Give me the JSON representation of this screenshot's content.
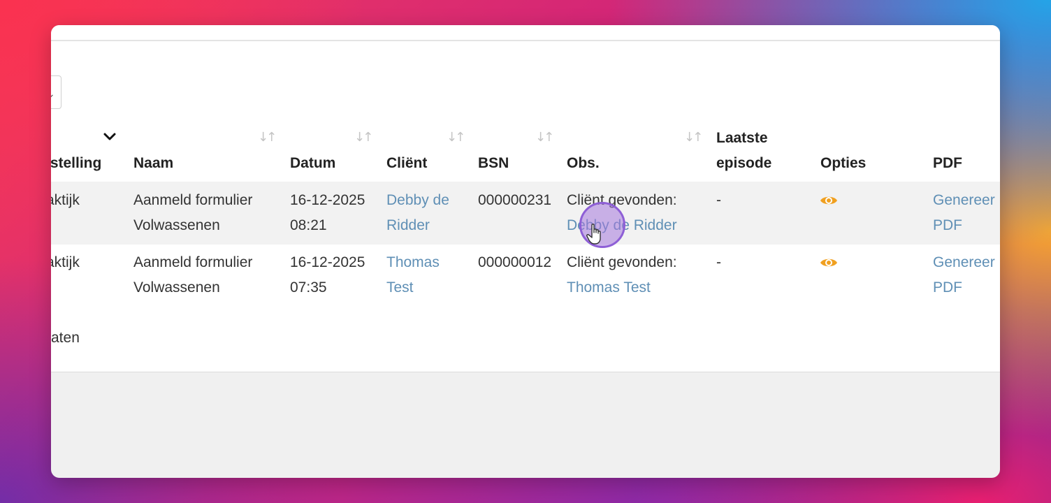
{
  "table": {
    "columns": {
      "instelling": "nstelling",
      "naam": "Naam",
      "datum": "Datum",
      "client": "Cliënt",
      "bsn": "BSN",
      "obs": "Obs.",
      "laatste_episode_line1": "Laatste",
      "laatste_episode_line2": "episode",
      "opties": "Opties",
      "pdf": "PDF"
    },
    "rows": [
      {
        "instelling": "raktijk",
        "naam": "Aanmeld formulier\nVolwassenen",
        "datum": "16-12-2025\n08:21",
        "client": "Debby de\nRidder",
        "bsn": "000000231",
        "obs_prefix": "Cliënt gevonden:",
        "obs_link": "Debby de Ridder",
        "laatste_episode": "-",
        "pdf": "Genereer\nPDF"
      },
      {
        "instelling": "raktijk",
        "naam": "Aanmeld formulier\nVolwassenen",
        "datum": "16-12-2025\n07:35",
        "client": "Thomas\nTest",
        "bsn": "000000012",
        "obs_prefix": "Cliënt gevonden:",
        "obs_link": "Thomas Test",
        "laatste_episode": "-",
        "pdf": "Genereer\nPDF"
      }
    ],
    "footer": "aten"
  },
  "colors": {
    "link": "#5f8fb5",
    "eye_icon": "#f0a020",
    "row_stripe": "#f2f2f2",
    "cursor_highlight": "#8e5fd6"
  },
  "icons": [
    "chevron-down-icon",
    "sort-icon",
    "eye-icon",
    "hand-pointer-icon"
  ]
}
